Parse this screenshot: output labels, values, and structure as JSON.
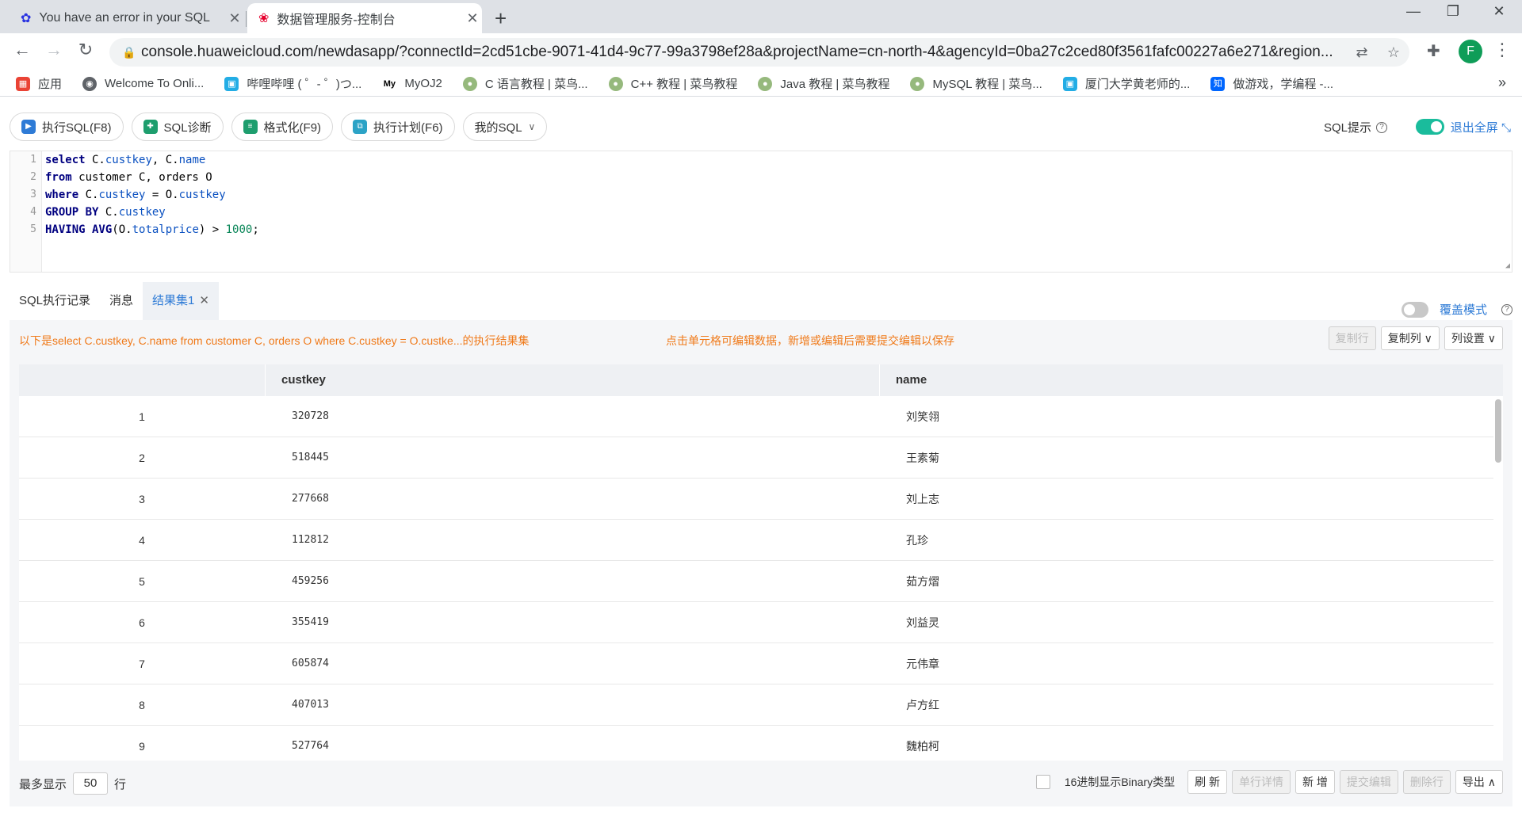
{
  "browser": {
    "tabs": [
      {
        "title": "You have an error in your SQL"
      },
      {
        "title": "数据管理服务-控制台"
      }
    ],
    "url": "console.huaweicloud.com/newdasapp/?connectId=2cd51cbe-9071-41d4-9c77-99a3798ef28a&projectName=cn-north-4&agencyId=0ba27c2ced80f3561fafc00227a6e271&region...",
    "profile_initial": "F",
    "bookmarks": [
      {
        "label": "应用",
        "icon": "apps-grid-icon"
      },
      {
        "label": "Welcome To Onli...",
        "icon": "globe-icon"
      },
      {
        "label": "哔哩哔哩 ( ゜- ゜)つ...",
        "icon": "bilibili-icon"
      },
      {
        "label": "MyOJ2",
        "icon": "myoj-icon"
      },
      {
        "label": "C 语言教程 | 菜鸟...",
        "icon": "runoob-icon"
      },
      {
        "label": "C++ 教程 | 菜鸟教程",
        "icon": "runoob-icon"
      },
      {
        "label": "Java 教程 | 菜鸟教程",
        "icon": "runoob-icon"
      },
      {
        "label": "MySQL 教程 | 菜鸟...",
        "icon": "runoob-icon"
      },
      {
        "label": "厦门大学黄老师的...",
        "icon": "bilibili-icon"
      },
      {
        "label": "做游戏，学编程 -...",
        "icon": "zhihu-icon"
      }
    ]
  },
  "toolbar": {
    "run_sql": "执行SQL(F8)",
    "diagnose": "SQL诊断",
    "format": "格式化(F9)",
    "plan": "执行计划(F6)",
    "my_sql": "我的SQL",
    "sql_hint": "SQL提示",
    "exit_fullscreen": "退出全屏"
  },
  "editor": {
    "line_numbers": [
      "1",
      "2",
      "3",
      "4",
      "5"
    ]
  },
  "result_tabs": {
    "history": "SQL执行记录",
    "messages": "消息",
    "result1": "结果集1",
    "cover_mode": "覆盖模式"
  },
  "result": {
    "info": "以下是select C.custkey, C.name from customer C, orders O where C.custkey = O.custke...的执行结果集",
    "edit_hint": "点击单元格可编辑数据，新增或编辑后需要提交编辑以保存",
    "buttons": {
      "copy_row": "复制行",
      "copy_col": "复制列",
      "col_settings": "列设置"
    },
    "columns": [
      "custkey",
      "name"
    ],
    "rows": [
      {
        "n": "1",
        "custkey": "320728",
        "name": "刘笑翎"
      },
      {
        "n": "2",
        "custkey": "518445",
        "name": "王素菊"
      },
      {
        "n": "3",
        "custkey": "277668",
        "name": "刘上志"
      },
      {
        "n": "4",
        "custkey": "112812",
        "name": "孔珍"
      },
      {
        "n": "5",
        "custkey": "459256",
        "name": "茹方熠"
      },
      {
        "n": "6",
        "custkey": "355419",
        "name": "刘益灵"
      },
      {
        "n": "7",
        "custkey": "605874",
        "name": "元伟章"
      },
      {
        "n": "8",
        "custkey": "407013",
        "name": "卢方红"
      },
      {
        "n": "9",
        "custkey": "527764",
        "name": "魏柏柯"
      }
    ],
    "footer": {
      "max_show": "最多显示",
      "max_value": "50",
      "row_unit": "行",
      "hex_binary": "16进制显示Binary类型",
      "refresh": "刷 新",
      "row_detail": "单行详情",
      "add": "新 增",
      "submit": "提交编辑",
      "delete": "删除行",
      "export": "导出"
    }
  }
}
